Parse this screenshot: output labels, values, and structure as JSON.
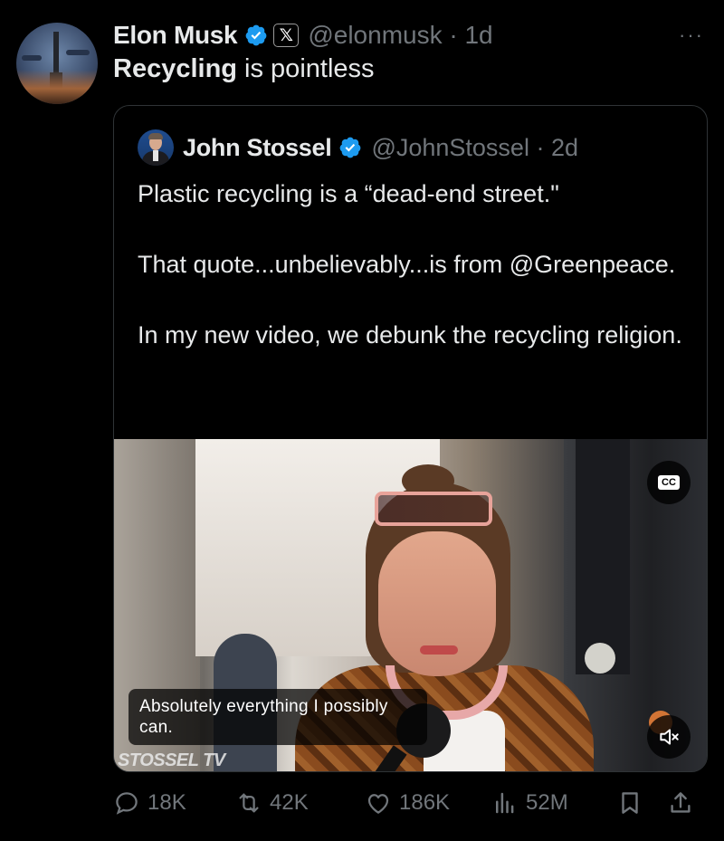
{
  "author": {
    "name": "Elon Musk",
    "handle": "@elonmusk",
    "time": "1d",
    "verified": true,
    "affiliation_badge": "𝕏"
  },
  "tweet": {
    "bold_word": "Recycling",
    "rest": " is pointless"
  },
  "more_menu": "···",
  "quoted": {
    "name": "John Stossel",
    "handle": "@JohnStossel",
    "time": "2d",
    "verified": true,
    "text": "Plastic recycling is a “dead-end street.\"\n\nThat quote...unbelievably...is from @Greenpeace.\n\nIn my new video, we debunk the recycling religion.",
    "video": {
      "cc_label": "CC",
      "caption": "Absolutely everything I possibly can.",
      "watermark": "STOSSEL TV",
      "muted": true
    }
  },
  "actions": {
    "replies": "18K",
    "reposts": "42K",
    "likes": "186K",
    "views": "52M"
  },
  "colors": {
    "background": "#000000",
    "text": "#e7e9ea",
    "secondary": "#71767b",
    "verified_blue": "#1d9bf0",
    "border": "#2f3336"
  }
}
